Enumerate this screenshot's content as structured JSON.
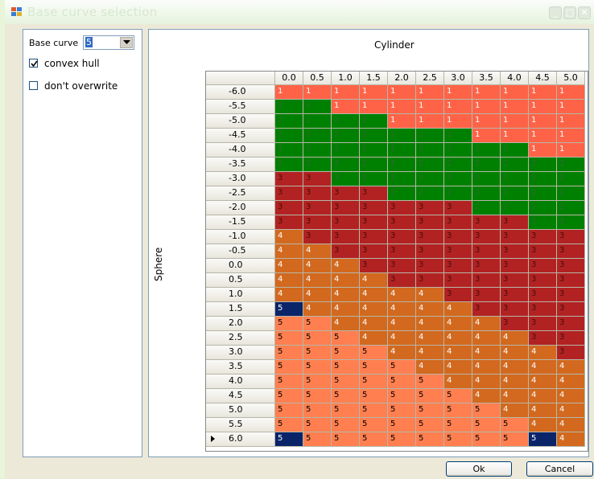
{
  "window": {
    "title": "Base curve selection"
  },
  "left_panel": {
    "base_curve_label": "Base curve",
    "base_curve_value": "5",
    "convex_hull_label": "convex hull",
    "convex_hull_checked": true,
    "dont_overwrite_label": "don't overwrite",
    "dont_overwrite_checked": false
  },
  "table": {
    "column_axis_label": "Cylinder",
    "row_axis_label": "Sphere",
    "columns": [
      "0.0",
      "0.5",
      "1.0",
      "1.5",
      "2.0",
      "2.5",
      "3.0",
      "3.5",
      "4.0",
      "4.5",
      "5.0"
    ],
    "rows": [
      {
        "sphere": "-6.0",
        "values": [
          "1",
          "1",
          "1",
          "1",
          "1",
          "1",
          "1",
          "1",
          "1",
          "1",
          "1"
        ]
      },
      {
        "sphere": "-5.5",
        "values": [
          "2",
          "2",
          "1",
          "1",
          "1",
          "1",
          "1",
          "1",
          "1",
          "1",
          "1"
        ]
      },
      {
        "sphere": "-5.0",
        "values": [
          "2",
          "2",
          "2",
          "2",
          "1",
          "1",
          "1",
          "1",
          "1",
          "1",
          "1"
        ]
      },
      {
        "sphere": "-4.5",
        "values": [
          "2",
          "2",
          "2",
          "2",
          "2",
          "2",
          "2",
          "1",
          "1",
          "1",
          "1"
        ]
      },
      {
        "sphere": "-4.0",
        "values": [
          "2",
          "2",
          "2",
          "2",
          "2",
          "2",
          "2",
          "2",
          "2",
          "1",
          "1"
        ]
      },
      {
        "sphere": "-3.5",
        "values": [
          "2",
          "2",
          "2",
          "2",
          "2",
          "2",
          "2",
          "2",
          "2",
          "2",
          "2"
        ]
      },
      {
        "sphere": "-3.0",
        "values": [
          "3",
          "3",
          "2",
          "2",
          "2",
          "2",
          "2",
          "2",
          "2",
          "2",
          "2"
        ]
      },
      {
        "sphere": "-2.5",
        "values": [
          "3",
          "3",
          "3",
          "3",
          "2",
          "2",
          "2",
          "2",
          "2",
          "2",
          "2"
        ]
      },
      {
        "sphere": "-2.0",
        "values": [
          "3",
          "3",
          "3",
          "3",
          "3",
          "3",
          "3",
          "2",
          "2",
          "2",
          "2"
        ]
      },
      {
        "sphere": "-1.5",
        "values": [
          "3",
          "3",
          "3",
          "3",
          "3",
          "3",
          "3",
          "3",
          "3",
          "2",
          "2"
        ]
      },
      {
        "sphere": "-1.0",
        "values": [
          "4",
          "3",
          "3",
          "3",
          "3",
          "3",
          "3",
          "3",
          "3",
          "3",
          "3"
        ]
      },
      {
        "sphere": "-0.5",
        "values": [
          "4",
          "4",
          "3",
          "3",
          "3",
          "3",
          "3",
          "3",
          "3",
          "3",
          "3"
        ]
      },
      {
        "sphere": "0.0",
        "values": [
          "4",
          "4",
          "4",
          "3",
          "3",
          "3",
          "3",
          "3",
          "3",
          "3",
          "3"
        ]
      },
      {
        "sphere": "0.5",
        "values": [
          "4",
          "4",
          "4",
          "4",
          "3",
          "3",
          "3",
          "3",
          "3",
          "3",
          "3"
        ]
      },
      {
        "sphere": "1.0",
        "values": [
          "4",
          "4",
          "4",
          "4",
          "4",
          "4",
          "3",
          "3",
          "3",
          "3",
          "3"
        ]
      },
      {
        "sphere": "1.5",
        "values": [
          "5",
          "4",
          "4",
          "4",
          "4",
          "4",
          "4",
          "3",
          "3",
          "3",
          "3"
        ]
      },
      {
        "sphere": "2.0",
        "values": [
          "5",
          "5",
          "4",
          "4",
          "4",
          "4",
          "4",
          "4",
          "3",
          "3",
          "3"
        ]
      },
      {
        "sphere": "2.5",
        "values": [
          "5",
          "5",
          "5",
          "4",
          "4",
          "4",
          "4",
          "4",
          "4",
          "3",
          "3"
        ]
      },
      {
        "sphere": "3.0",
        "values": [
          "5",
          "5",
          "5",
          "5",
          "4",
          "4",
          "4",
          "4",
          "4",
          "4",
          "3"
        ]
      },
      {
        "sphere": "3.5",
        "values": [
          "5",
          "5",
          "5",
          "5",
          "5",
          "4",
          "4",
          "4",
          "4",
          "4",
          "4"
        ]
      },
      {
        "sphere": "4.0",
        "values": [
          "5",
          "5",
          "5",
          "5",
          "5",
          "5",
          "4",
          "4",
          "4",
          "4",
          "4"
        ]
      },
      {
        "sphere": "4.5",
        "values": [
          "5",
          "5",
          "5",
          "5",
          "5",
          "5",
          "5",
          "4",
          "4",
          "4",
          "4"
        ]
      },
      {
        "sphere": "5.0",
        "values": [
          "5",
          "5",
          "5",
          "5",
          "5",
          "5",
          "5",
          "5",
          "4",
          "4",
          "4"
        ]
      },
      {
        "sphere": "5.5",
        "values": [
          "5",
          "5",
          "5",
          "5",
          "5",
          "5",
          "5",
          "5",
          "5",
          "4",
          "4"
        ]
      },
      {
        "sphere": "6.0",
        "values": [
          "5",
          "5",
          "5",
          "5",
          "5",
          "5",
          "5",
          "5",
          "5",
          "5",
          "4"
        ]
      }
    ],
    "current_row": "6.0",
    "selected_cells": [
      {
        "sphere": "1.5",
        "cylinder": "0.0"
      },
      {
        "sphere": "6.0",
        "cylinder": "0.0"
      },
      {
        "sphere": "6.0",
        "cylinder": "4.5"
      }
    ],
    "value_colors": {
      "1": "#ff6347",
      "2": "#008000",
      "3": "#b22222",
      "4": "#d2691e",
      "5": "#ff7f50",
      "selected": "#0a246a"
    }
  },
  "buttons": {
    "ok": "Ok",
    "cancel": "Cancel"
  }
}
